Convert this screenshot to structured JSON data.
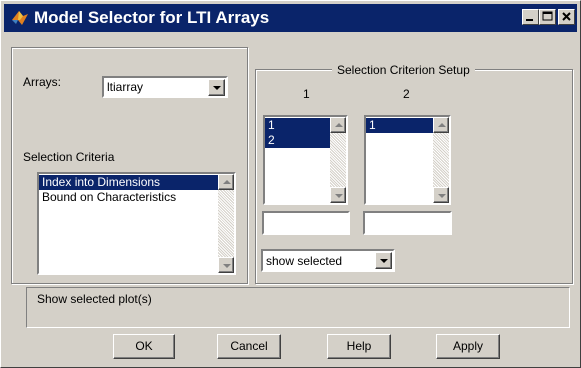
{
  "window": {
    "title": "Model Selector for LTI Arrays",
    "controls": [
      "minimize-icon",
      "maximize-icon",
      "close-icon"
    ]
  },
  "arrays": {
    "label": "Arrays:",
    "selected": "ltiarray"
  },
  "selection_criteria": {
    "label": "Selection Criteria",
    "items": [
      {
        "label": "Index into Dimensions",
        "selected": true
      },
      {
        "label": "Bound on Characteristics",
        "selected": false
      }
    ]
  },
  "setup": {
    "title": "Selection Criterion Setup",
    "col1_header": "1",
    "col2_header": "2",
    "list1": [
      {
        "label": "1",
        "selected": true
      },
      {
        "label": "2",
        "selected": true
      }
    ],
    "list2": [
      {
        "label": "1",
        "selected": true
      }
    ],
    "field1_value": "",
    "field2_value": "",
    "show_dropdown": "show selected"
  },
  "status": {
    "text": "Show selected plot(s)"
  },
  "buttons": {
    "ok": "OK",
    "cancel": "Cancel",
    "help": "Help",
    "apply": "Apply"
  }
}
